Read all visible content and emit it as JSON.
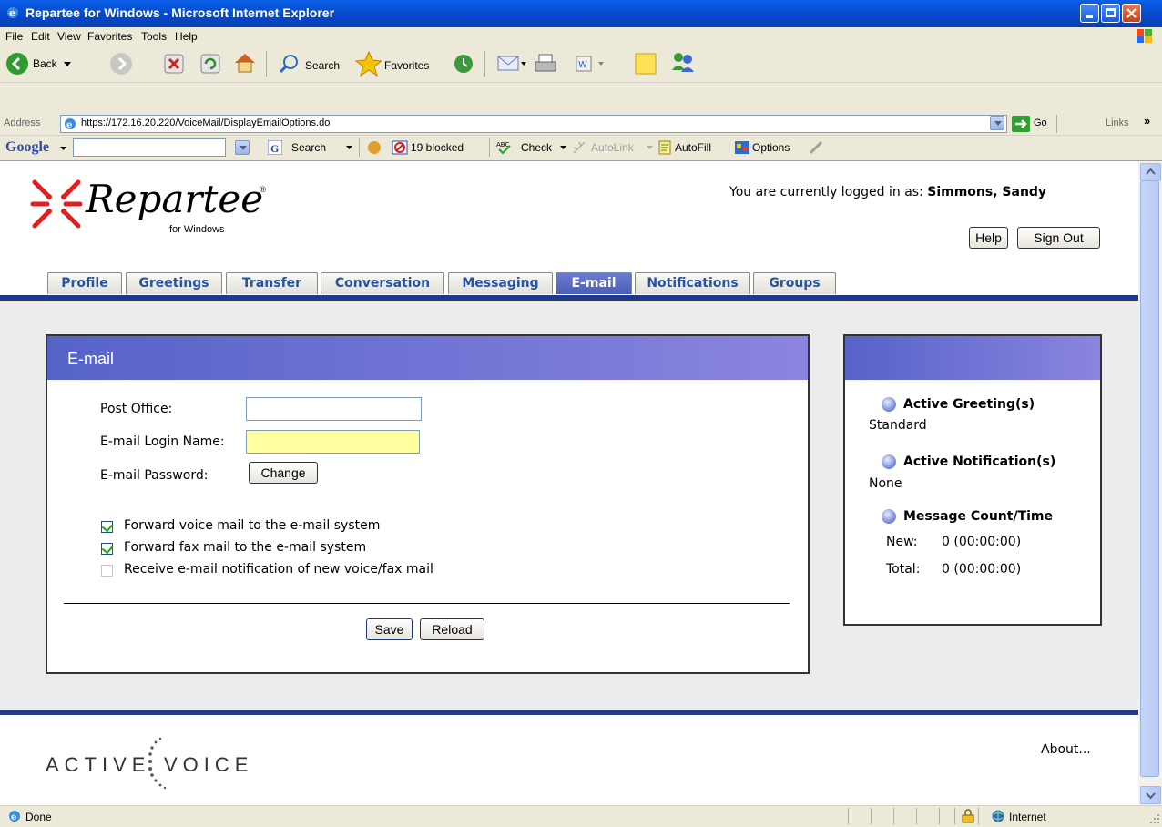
{
  "window": {
    "title": "Repartee for Windows - Microsoft Internet Explorer"
  },
  "menu": {
    "items": [
      "File",
      "Edit",
      "View",
      "Favorites",
      "Tools",
      "Help"
    ]
  },
  "toolbar": {
    "back_label": "Back",
    "search_label": "Search",
    "favorites_label": "Favorites"
  },
  "address": {
    "label": "Address",
    "url": "https://172.16.20.220/VoiceMail/DisplayEmailOptions.do",
    "go_label": "Go",
    "links_label": "Links"
  },
  "google_bar": {
    "brand": "Google",
    "search_label": "Search",
    "blocked_label": "19 blocked",
    "check_label": "Check",
    "autolink_label": "AutoLink",
    "autofill_label": "AutoFill",
    "options_label": "Options"
  },
  "header": {
    "logo_main": "Repartee",
    "logo_sub": "for Windows",
    "logged_prefix": "You are currently logged in as:",
    "user_name": "Simmons, Sandy",
    "help_label": "Help",
    "signout_label": "Sign Out"
  },
  "tabs": [
    {
      "label": "Profile",
      "active": false
    },
    {
      "label": "Greetings",
      "active": false
    },
    {
      "label": "Transfer",
      "active": false
    },
    {
      "label": "Conversation",
      "active": false
    },
    {
      "label": "Messaging",
      "active": false
    },
    {
      "label": "E-mail",
      "active": true
    },
    {
      "label": "Notifications",
      "active": false
    },
    {
      "label": "Groups",
      "active": false
    }
  ],
  "email_panel": {
    "title": "E-mail",
    "post_office_label": "Post Office:",
    "post_office_value": "",
    "login_name_label": "E-mail Login Name:",
    "login_name_value": "",
    "password_label": "E-mail Password:",
    "change_label": "Change",
    "checkboxes": [
      {
        "label": "Forward voice mail to the e-mail system",
        "checked": true,
        "enabled": true
      },
      {
        "label": "Forward fax mail to the e-mail system",
        "checked": true,
        "enabled": true
      },
      {
        "label": "Receive e-mail notification of new voice/fax mail",
        "checked": false,
        "enabled": false
      }
    ],
    "save_label": "Save",
    "reload_label": "Reload"
  },
  "side_panel": {
    "active_greeting_title": "Active Greeting(s)",
    "active_greeting_value": "Standard",
    "active_notification_title": "Active Notification(s)",
    "active_notification_value": "None",
    "message_count_title": "Message Count/Time",
    "new_label": "New:",
    "new_value": "0 (00:00:00)",
    "total_label": "Total:",
    "total_value": "0 (00:00:00)"
  },
  "footer": {
    "brand_left": "ACTIVE",
    "brand_right": "VOICE",
    "about_label": "About..."
  },
  "status": {
    "text": "Done",
    "zone": "Internet"
  },
  "colors": {
    "accent_blue": "#1F3A8C",
    "tab_active": "#5563C8",
    "tab_text": "#2753A0",
    "highlight_yellow": "#FFFFA0"
  }
}
